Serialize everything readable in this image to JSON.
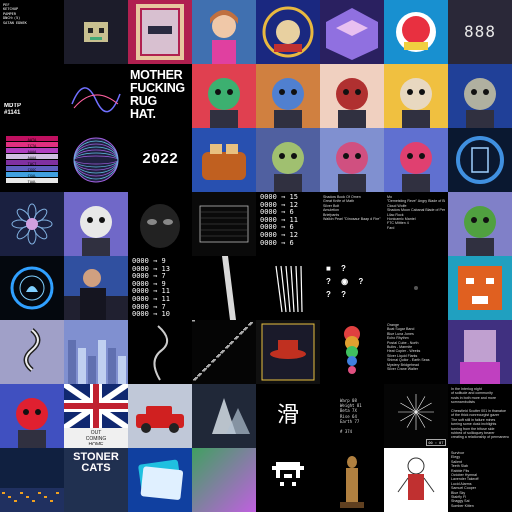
{
  "gallery": {
    "tiles": [
      {
        "id": "r0c0",
        "bg": "#000000",
        "text": "PEF\nKETCHUP\nPAMPER\nDNCH:(5)\nSATAN EDNEK",
        "text_style": "t-mono-small",
        "fg": "#ffffff",
        "kind": "text"
      },
      {
        "id": "r0c1",
        "bg": "#1c1c2a",
        "kind": "pixel-skull",
        "accent": "#c8c090"
      },
      {
        "id": "r0c2",
        "bg": "#b02050",
        "kind": "framed",
        "accent": "#e8c8a0"
      },
      {
        "id": "r0c3",
        "bg": "#4070b0",
        "kind": "anime-portrait",
        "accent": "#e040a0"
      },
      {
        "id": "r0c4",
        "bg": "#1a2880",
        "kind": "ornate",
        "accent": "#e8b840"
      },
      {
        "id": "r0c5",
        "bg": "#2a2060",
        "kind": "iso-room",
        "accent": "#9070e0"
      },
      {
        "id": "r0c6",
        "bg": "#1890d0",
        "kind": "sticker",
        "accent": "#e83040"
      },
      {
        "id": "r0c7",
        "bg": "#2a2838",
        "text": "888",
        "text_style": "t-digits",
        "fg": "#e8e8e8",
        "kind": "text"
      },
      {
        "id": "r1c0",
        "bg": "#000000",
        "text": "MDTP\n#1141",
        "text_style": "t-label",
        "fg": "#ffffff",
        "kind": "text"
      },
      {
        "id": "r1c1",
        "bg": "#000000",
        "kind": "glitch-line",
        "accent": "#7070ff"
      },
      {
        "id": "r1c2",
        "bg": "#000000",
        "text": "MOTHER\nFUCKING\nRUG\nHAT.",
        "text_style": "t-headline",
        "fg": "#ffffff",
        "kind": "text"
      },
      {
        "id": "r1c3",
        "bg": "#e04050",
        "kind": "character",
        "accent": "#3cb070"
      },
      {
        "id": "r1c4",
        "bg": "#d08040",
        "kind": "character",
        "accent": "#5080d0"
      },
      {
        "id": "r1c5",
        "bg": "#f0d0c0",
        "kind": "character",
        "accent": "#b03030"
      },
      {
        "id": "r1c6",
        "bg": "#f0c040",
        "kind": "character",
        "accent": "#e8d8c0"
      },
      {
        "id": "r1c7",
        "bg": "#204098",
        "kind": "character",
        "accent": "#b0b0a0"
      },
      {
        "id": "r2c0",
        "bg": "#000000",
        "kind": "color-bars",
        "bars": [
          "#c01060",
          "#e03080",
          "#b040c0",
          "#d0c0e0",
          "#8030a0",
          "#6060c0",
          "#40a0e0",
          "#e8e8e8"
        ],
        "codes": [
          "AATA",
          "TCTA",
          "AAAA",
          "AAAA",
          "TACT",
          "CGGC",
          "CGAL",
          "TAAL"
        ]
      },
      {
        "id": "r2c1",
        "bg": "#000000",
        "kind": "sphere",
        "accent": "#a060e0"
      },
      {
        "id": "r2c2",
        "bg": "#000000",
        "text": "2022",
        "text_style": "t-year",
        "fg": "#ffffff",
        "kind": "text"
      },
      {
        "id": "r2c3",
        "bg": "#2850b0",
        "kind": "toaster",
        "accent": "#c06020"
      },
      {
        "id": "r2c4",
        "bg": "#5060a0",
        "kind": "character",
        "accent": "#a0c070"
      },
      {
        "id": "r2c5",
        "bg": "#8090d0",
        "kind": "character",
        "accent": "#d05080"
      },
      {
        "id": "r2c6",
        "bg": "#6070d0",
        "kind": "character",
        "accent": "#e04070"
      },
      {
        "id": "r2c7",
        "bg": "#0a1830",
        "kind": "portal",
        "accent": "#4090e0"
      },
      {
        "id": "r3c0",
        "bg": "#1a2040",
        "kind": "mandala",
        "accent": "#80b0e0"
      },
      {
        "id": "r3c1",
        "bg": "#7068c8",
        "kind": "character",
        "accent": "#e8e8e8"
      },
      {
        "id": "r3c2",
        "bg": "#000000",
        "kind": "dark-mask",
        "accent": "#888888"
      },
      {
        "id": "r3c3",
        "bg": "#0a0a0a",
        "kind": "wire-box",
        "accent": "#bbbbbb"
      },
      {
        "id": "r3c4",
        "bg": "#000000",
        "text": "0000 ⇒ 15\n0000 ⇒ 12\n0000 ⇒ 6\n0000 ⇒ 11\n0000 ⇒ 6\n0000 ⇒ 12\n0000 ⇒ 6",
        "text_style": "t-codes",
        "fg": "#ffffff",
        "kind": "text"
      },
      {
        "id": "r3c5",
        "bg": "#000000",
        "text": "Shadow Book Of Omen\nGreat Knife of Math\nSilver Bolt\nAmuletion\nBriefpants\nWalkin Pearl \"Dinosaur Baap d Fire\" +1",
        "text_style": "t-small",
        "fg": "#dddddd",
        "kind": "text"
      },
      {
        "id": "r3c6",
        "bg": "#000000",
        "text": "Mo\n\"Demeisting Reve\" Angry Blade of Bill +1\nCloud Wolfe\nShadow Moon Cabanal Blade of Perfection\nLilac Rock\nHonicamic Mantel\nFTC Mittten 4\nFard",
        "text_style": "t-small",
        "fg": "#dddddd",
        "kind": "text"
      },
      {
        "id": "r3c7",
        "bg": "#8080c8",
        "kind": "character",
        "accent": "#50a040"
      },
      {
        "id": "r4c0",
        "bg": "#04080e",
        "kind": "neon-ring",
        "accent": "#30a0ff"
      },
      {
        "id": "r4c1",
        "bg": "#3050a0",
        "kind": "photo",
        "accent": "#b0b0c0"
      },
      {
        "id": "r4c2",
        "bg": "#000000",
        "text": "0000 ⇒ 9\n0000 ⇒ 13\n0000 ⇒ 7\n0000 ⇒ 9\n0000 ⇒ 11\n0000 ⇒ 11\n0000 ⇒ 7\n0000 ⇒ 10",
        "text_style": "t-codes",
        "fg": "#ffffff",
        "kind": "text"
      },
      {
        "id": "r4c3",
        "bg": "#000000",
        "kind": "light-beam",
        "accent": "#ffffff"
      },
      {
        "id": "r4c4",
        "bg": "#000000",
        "kind": "hand-draw",
        "accent": "#ffffff"
      },
      {
        "id": "r4c5",
        "bg": "#000000",
        "text": "■ ?\n? ◉ ?\n? ?",
        "text_style": "t-qmarks",
        "fg": "#ffffff",
        "kind": "text"
      },
      {
        "id": "r4c6",
        "bg": "#000000",
        "kind": "dark-dots",
        "accent": "#555555"
      },
      {
        "id": "r4c7",
        "bg": "#20a0c0",
        "kind": "tiger",
        "accent": "#e06020"
      },
      {
        "id": "r5c0",
        "bg": "#a0a0c8",
        "kind": "spiral-figure",
        "accent": "#202020"
      },
      {
        "id": "r5c1",
        "bg": "#8090d0",
        "kind": "cityscape",
        "accent": "#c0d0f0"
      },
      {
        "id": "r5c2",
        "bg": "#000000",
        "kind": "smoke",
        "accent": "#cccccc"
      },
      {
        "id": "r5c3",
        "bg": "#050505",
        "kind": "static",
        "accent": "#aaaaaa"
      },
      {
        "id": "r5c4",
        "bg": "#101010",
        "kind": "hat-card",
        "accent": "#c03020"
      },
      {
        "id": "r5c5",
        "bg": "#000000",
        "kind": "rainbow-figure",
        "accent": "#e05080"
      },
      {
        "id": "r5c6",
        "bg": "#000000",
        "text": "Orange\nBoat Sugar Band\nBlue Luna Jones\nEcho Rhythm\nPostal Cube - North\nBulbs - Marmite\nHeat Copier - Weeks\nSilver Liquid Flarks\nShimai Quilor - Earth Seas\nMystery Bridgehead\nSilver Crane Walter",
        "text_style": "t-small",
        "fg": "#dddddd",
        "kind": "text"
      },
      {
        "id": "r5c7",
        "bg": "#403080",
        "kind": "pixel-portrait",
        "accent": "#c040c0"
      },
      {
        "id": "r6c0",
        "bg": "#4050c0",
        "kind": "character",
        "accent": "#e02030"
      },
      {
        "id": "r6c1",
        "bg": "#c02030",
        "kind": "union-flag",
        "accent": "#102870",
        "text": "OUT\nCOMING\nHOME",
        "text_style": "t-center-small",
        "fg": "#222222"
      },
      {
        "id": "r6c2",
        "bg": "#c0c8d8",
        "kind": "car",
        "accent": "#d02020"
      },
      {
        "id": "r6c3",
        "bg": "#202838",
        "kind": "crystal",
        "accent": "#e0e8f0"
      },
      {
        "id": "r6c4",
        "bg": "#000000",
        "text": "滑",
        "text_style": "t-kanji",
        "fg": "#ffffff",
        "kind": "text"
      },
      {
        "id": "r6c5",
        "bg": "#000000",
        "text": "Warp 08\nWeight 81\nBeta 7X\nRise 64\nEarth 77\n\n# 374",
        "text_style": "t-stats",
        "fg": "#dddddd",
        "kind": "text"
      },
      {
        "id": "r6c6",
        "bg": "#050505",
        "kind": "starburst",
        "badge": "00 : 07",
        "accent": "#ffffff"
      },
      {
        "id": "r6c7",
        "bg": "#000000",
        "text": "In the Interlog night\nof solitude and community\nrusts in both more and more\nsomnambulists\n\nChessfield Scutter 001 in thanatoe\nof the thick nonrecurgist gazer\nThe soft still in failure mines\nturning some dusk inchlights\nturning from the trifuse side\nrubbed of soliloquey bearer\ncreating a relationship of permanence",
        "text_style": "t-small",
        "fg": "#dddddd",
        "kind": "text"
      },
      {
        "id": "r7c0",
        "bg": "#102040",
        "kind": "night-city",
        "accent": "#f0a020"
      },
      {
        "id": "r7c1",
        "bg": "#203050",
        "text": "STONER\nCATS",
        "text_style": "t-stoner",
        "fg": "#ffffff",
        "kind": "text"
      },
      {
        "id": "r7c2",
        "bg": "#1040a0",
        "kind": "cards",
        "accent": "#20c0e0"
      },
      {
        "id": "r7c3",
        "bg": "#40a060",
        "kind": "gradient",
        "accent": "#c060e0"
      },
      {
        "id": "r7c4",
        "bg": "#000000",
        "kind": "pixel-invader",
        "accent": "#ffffff"
      },
      {
        "id": "r7c5",
        "bg": "#000000",
        "kind": "statue",
        "accent": "#b08040"
      },
      {
        "id": "r7c6",
        "bg": "#ffffff",
        "kind": "sketch-figure",
        "accent": "#c03030"
      },
      {
        "id": "r7c7",
        "bg": "#000000",
        "text": "Survivor\nElegy\nSalient\nTeeth Slab\nRabble Fits\nOctober Hymnal\nLavender Takeoff\nLucid Alarms\nSamuel Cooper\nBlue Sky\nStairfly Fl\nShaggy Sal\nSomber Kitten",
        "text_style": "t-small",
        "fg": "#dddddd",
        "kind": "text"
      }
    ]
  }
}
